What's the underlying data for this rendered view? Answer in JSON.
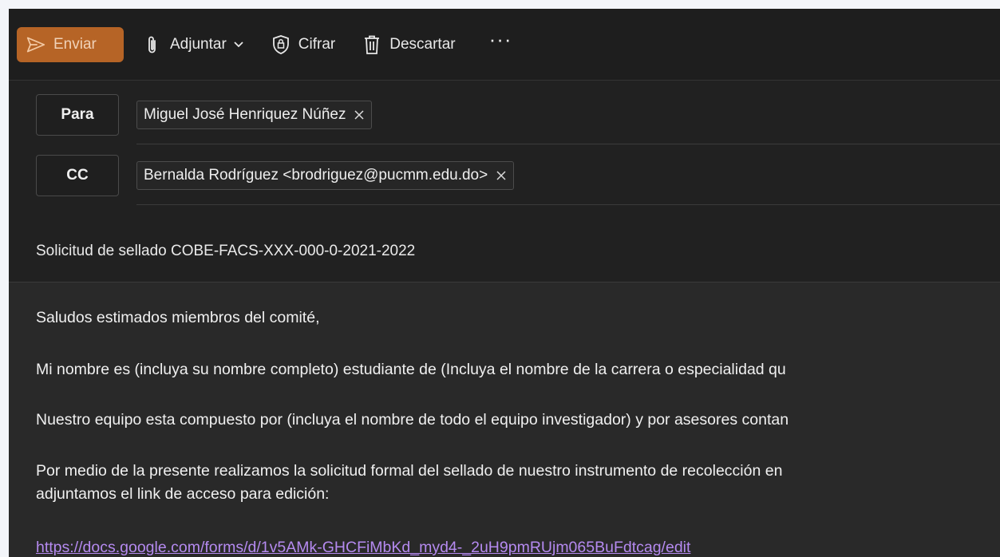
{
  "toolbar": {
    "send_label": "Enviar",
    "attach_label": "Adjuntar",
    "encrypt_label": "Cifrar",
    "discard_label": "Descartar",
    "more_label": "···"
  },
  "recipients": {
    "to_label": "Para",
    "to_chip": "Miguel José Henriquez Núñez",
    "cc_label": "CC",
    "cc_chip": "Bernalda Rodríguez <brodriguez@pucmm.edu.do>"
  },
  "subject": "Solicitud de sellado COBE-FACS-XXX-000-0-2021-2022",
  "body": {
    "greeting": "Saludos estimados miembros del comité,",
    "p2": "Mi nombre es (incluya su nombre completo) estudiante de (Incluya el nombre de la carrera o especialidad qu",
    "p3": "Nuestro equipo esta compuesto por (incluya el nombre de todo el equipo investigador) y por asesores contan",
    "p4_line1": "Por medio de la presente realizamos la solicitud formal del sellado de nuestro instrumento de recolección en",
    "p4_line2": "adjuntamos el link de acceso para edición:",
    "link": "https://docs.google.com/forms/d/1v5AMk-GHCFiMbKd_myd4-_2uH9pmRUjm065BuFdtcag/edit"
  },
  "colors": {
    "send_button": "#b66426",
    "toolbar_bg": "#1e1e1e",
    "header_bg": "#212121",
    "body_bg": "#292929",
    "link": "#b58af0"
  },
  "icons": [
    "send-icon",
    "paperclip-icon",
    "chevron-down-icon",
    "lock-shield-icon",
    "trash-icon",
    "more-icon",
    "close-icon"
  ]
}
